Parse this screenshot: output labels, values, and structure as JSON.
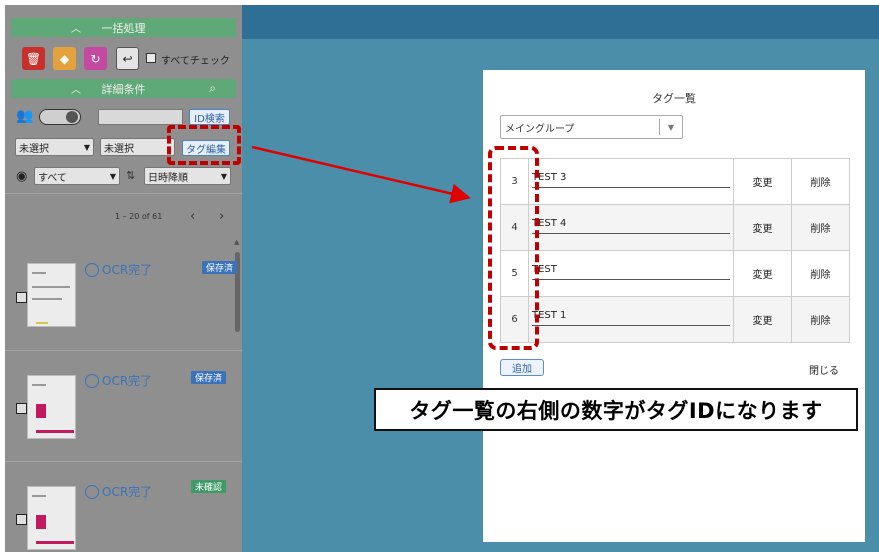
{
  "sidebar": {
    "batch_header": "一括処理",
    "select_all_label": "すべてチェック",
    "detail_header": "詳細条件",
    "id_search_label": "ID検索",
    "tag_edit_label": "タグ編集",
    "filter1_value": "未選択",
    "filter2_value": "未選択",
    "view_filter_value": "すべて",
    "sort_value": "日時降順",
    "pager_text": "1 – 20 of 61",
    "items": [
      {
        "status": "OCR完了",
        "badge": "保存済",
        "badge_color": "#3a73b9"
      },
      {
        "status": "OCR完了",
        "badge": "保存済",
        "badge_color": "#3a73b9"
      },
      {
        "status": "OCR完了",
        "badge": "未確認",
        "badge_color": "#3f9a68"
      }
    ]
  },
  "modal": {
    "title": "タグ一覧",
    "group_value": "メイングループ",
    "rows": [
      {
        "id": "3",
        "name": "TEST 3",
        "edit": "変更",
        "delete": "削除"
      },
      {
        "id": "4",
        "name": "TEST 4",
        "edit": "変更",
        "delete": "削除"
      },
      {
        "id": "5",
        "name": "TEST",
        "edit": "変更",
        "delete": "削除"
      },
      {
        "id": "6",
        "name": "TEST 1",
        "edit": "変更",
        "delete": "削除"
      }
    ],
    "add_label": "追加",
    "close_label": "閉じる"
  },
  "annotation": {
    "text": "タグ一覧の右側の数字がタグIDになります"
  },
  "colors": {
    "accent_red": "#c00000",
    "header_green": "#5fa877",
    "main_blue": "#4a8ea9"
  }
}
